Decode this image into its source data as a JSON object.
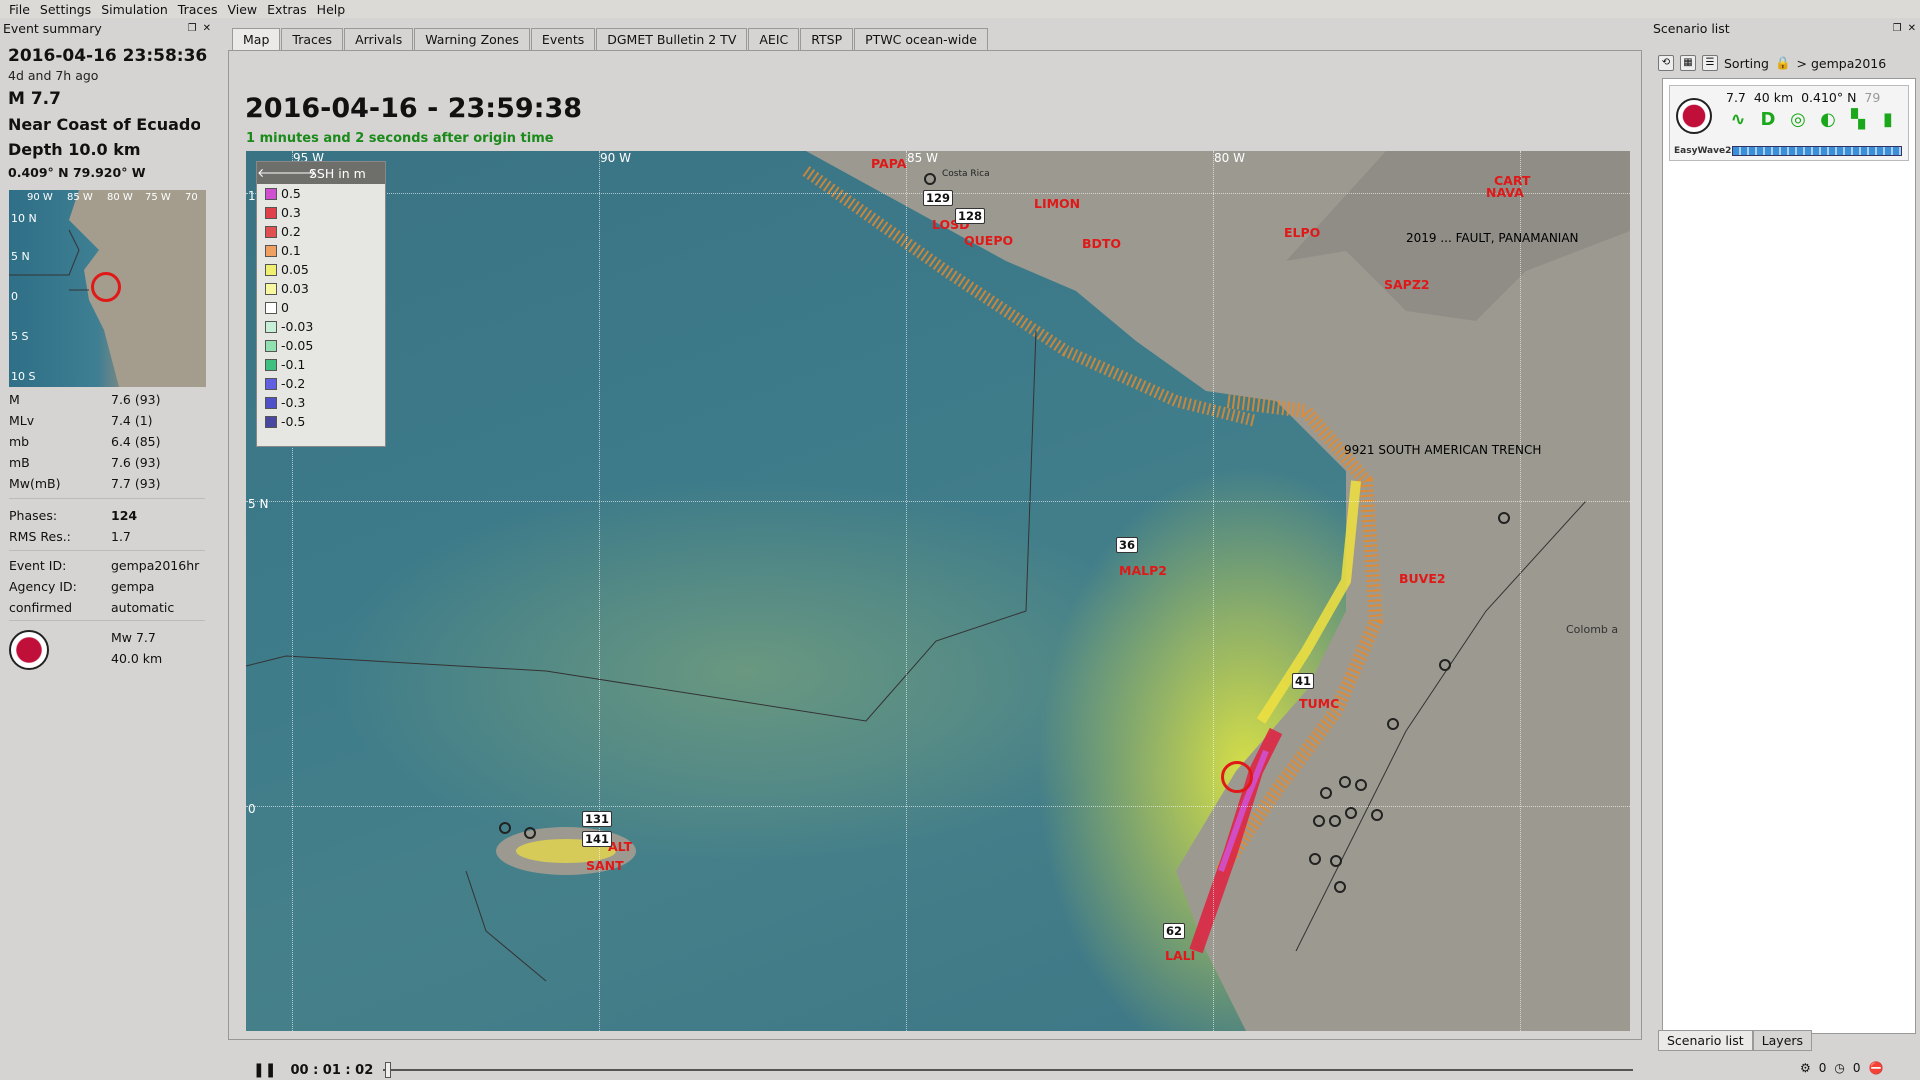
{
  "menu": [
    "File",
    "Settings",
    "Simulation",
    "Traces",
    "View",
    "Extras",
    "Help"
  ],
  "event_summary": {
    "title": "Event summary",
    "time": "2016-04-16 23:58:36",
    "ago": "4d and 7h ago",
    "magnitude": "M 7.7",
    "region": "Near Coast of Ecuador",
    "depth": "Depth 10.0 km",
    "coords": "0.409° N  79.920° W",
    "minimap": {
      "lats": [
        "10 N",
        "5 N",
        "0",
        "5 S",
        "10 S"
      ],
      "lons": [
        "90 W",
        "85 W",
        "80 W",
        "75 W",
        "70"
      ]
    },
    "magnitudes": [
      {
        "k": "M",
        "v": "7.6 (93)"
      },
      {
        "k": "MLv",
        "v": "7.4 (1)"
      },
      {
        "k": "mb",
        "v": "6.4 (85)"
      },
      {
        "k": "mB",
        "v": "7.6 (93)"
      },
      {
        "k": "Mw(mB)",
        "v": "7.7 (93)"
      }
    ],
    "phases_label": "Phases:",
    "phases": "124",
    "rms_label": "RMS Res.:",
    "rms": "1.7",
    "event_id_label": "Event ID:",
    "event_id": "gempa2016hr",
    "agency_label": "Agency ID:",
    "agency": "gempa",
    "status_label": "confirmed",
    "status": "automatic",
    "fm_mag": "Mw 7.7",
    "fm_depth": "40.0 km"
  },
  "tabs": [
    "Map",
    "Traces",
    "Arrivals",
    "Warning Zones",
    "Events",
    "DGMET Bulletin 2 TV",
    "AEIC",
    "RTSP",
    "PTWC ocean-wide"
  ],
  "map": {
    "title": "2016-04-16 - 23:59:38",
    "subtitle": "1 minutes and 2 seconds after origin time",
    "lon_labels": [
      "95 W",
      "90 W",
      "85 W",
      "80 W"
    ],
    "lat_labels": [
      "10 N",
      "5 N",
      "0"
    ],
    "legend": {
      "title": "SSH in m",
      "rows": [
        {
          "label": "0.5",
          "color": "#d04fd0"
        },
        {
          "label": "0.3",
          "color": "#e0404a"
        },
        {
          "label": "0.2",
          "color": "#e05050"
        },
        {
          "label": "0.1",
          "color": "#f0a060"
        },
        {
          "label": "0.05",
          "color": "#f0f070"
        },
        {
          "label": "0.03",
          "color": "#f8f8a0"
        },
        {
          "label": "0",
          "color": "#ffffff"
        },
        {
          "label": "-0.03",
          "color": "#c8f0d8"
        },
        {
          "label": "-0.05",
          "color": "#90e0b0"
        },
        {
          "label": "-0.1",
          "color": "#40c080"
        },
        {
          "label": "-0.2",
          "color": "#6060e0"
        },
        {
          "label": "-0.3",
          "color": "#5050c8"
        },
        {
          "label": "-0.5",
          "color": "#4848a0"
        }
      ]
    },
    "stations": [
      "PAPA",
      "LOSD",
      "QUEPO",
      "LIMON",
      "BDTO",
      "ELPO",
      "SAPZ2",
      "CART",
      "NAVA",
      "MALP2",
      "BUVE2",
      "TUMC",
      "LALI",
      "SANT",
      "ALT"
    ],
    "badges": [
      "129",
      "128",
      "36",
      "41",
      "62",
      "131",
      "141"
    ],
    "labels": {
      "trench": "9921 SOUTH AMERICAN TRENCH",
      "fault": "2019 ... FAULT, PANAMANIAN",
      "costa_rica": "Costa Rica",
      "colombia": "Colomb a"
    },
    "time": "00 : 01 : 02"
  },
  "scenario": {
    "title": "Scenario list",
    "sorting": "Sorting",
    "path": "> gempa2016",
    "item": {
      "mag": "7.7",
      "depth": "40 km",
      "lat": "0.410° N",
      "extra": "79",
      "model": "EasyWave2",
      "progress": 1.0
    },
    "tabs": [
      "Scenario list",
      "Layers"
    ]
  },
  "statusbar": {
    "a": "0",
    "b": "0"
  }
}
